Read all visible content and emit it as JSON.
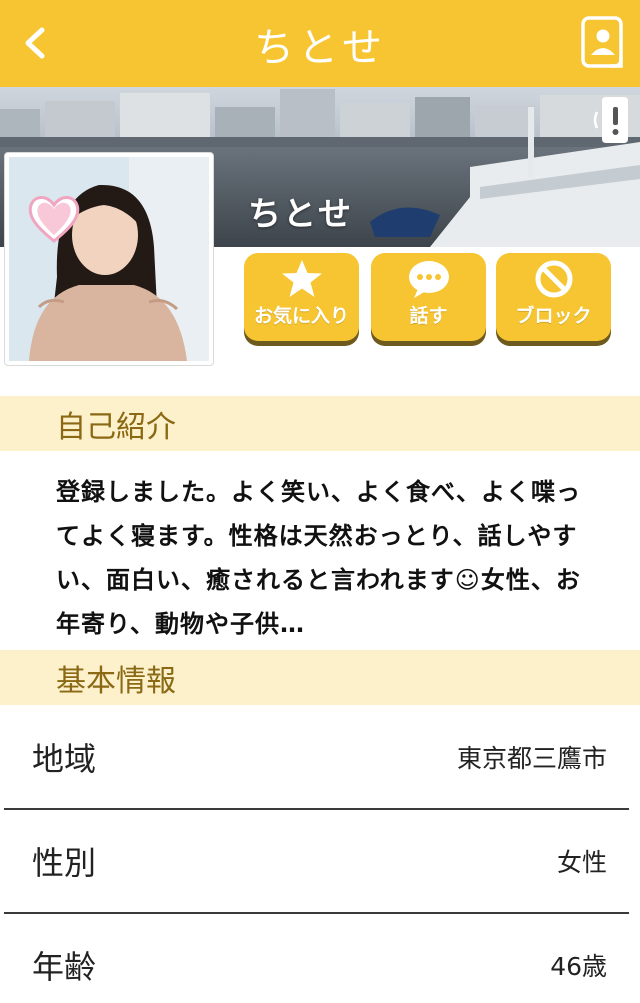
{
  "header": {
    "title": "ちとせ",
    "back_icon": "chevron-left-icon",
    "contact_icon": "contact-card-icon"
  },
  "profile": {
    "name": "ちとせ",
    "report_icon": "report-icon",
    "avatar_icon": "heart-icon"
  },
  "actions": {
    "favorite": {
      "label": "お気に入り",
      "icon": "star-icon"
    },
    "talk": {
      "label": "話す",
      "icon": "speech-bubble-icon"
    },
    "block": {
      "label": "ブロック",
      "icon": "prohibited-icon"
    }
  },
  "intro": {
    "heading": "自己紹介",
    "text": "登録しました。よく笑い、よく食べ、よく喋ってよく寝ます。性格は天然おっとり、話しやすい、面白い、癒されると言われます☺女性、お年寄り、動物や子供…"
  },
  "basic": {
    "heading": "基本情報",
    "rows": [
      {
        "label": "地域",
        "value": "東京都三鷹市"
      },
      {
        "label": "性別",
        "value": "女性"
      },
      {
        "label": "年齢",
        "value": "46歳"
      }
    ]
  },
  "colors": {
    "accent": "#f6c531",
    "section_bg": "#fdf1cc",
    "section_text": "#8b6914"
  }
}
